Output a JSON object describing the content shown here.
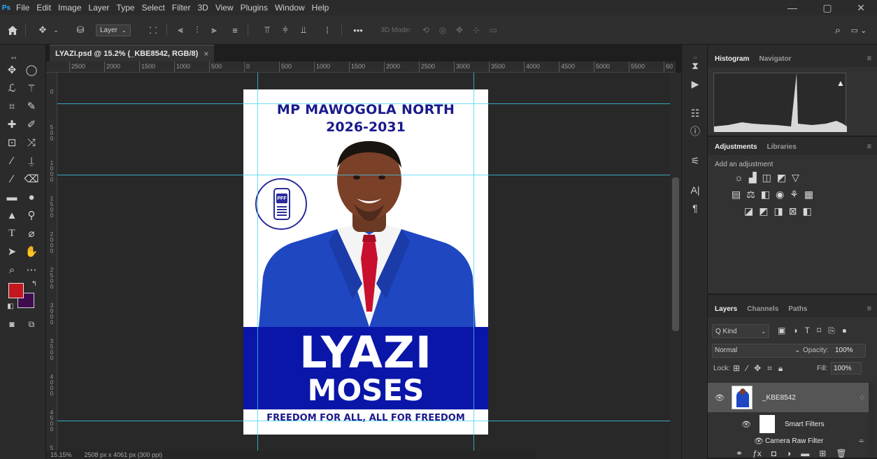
{
  "menubar": {
    "logo": "Ps",
    "items": [
      "File",
      "Edit",
      "Image",
      "Layer",
      "Type",
      "Select",
      "Filter",
      "3D",
      "View",
      "Plugins",
      "Window",
      "Help"
    ],
    "minimize": "—",
    "maximize": "▢",
    "close": "✕"
  },
  "options": {
    "home_icon": "home-icon",
    "layer_dropdown": "Layer",
    "more": "•••",
    "mode_3d": "3D Mode:"
  },
  "document": {
    "tab_title": "LYAZI.psd @ 15.2% (_KBE8542, RGB/8)",
    "tab_close": "×",
    "poster": {
      "heading": "MP MAWOGOLA NORTH",
      "years": "2026-2031",
      "logo_text": "PFF",
      "name_first": "LYAZI",
      "name_last": "MOSES",
      "slogan": "FREEDOM FOR ALL, ALL FOR FREEDOM",
      "banner_color": "#0a16a8",
      "heading_color": "#1a1a8c"
    }
  },
  "ruler_h_labels": [
    "2500",
    "2000",
    "1500",
    "1000",
    "500",
    "0",
    "500",
    "1000",
    "1500",
    "2000",
    "2500",
    "3000",
    "3500",
    "4000",
    "4500",
    "5000",
    "5500",
    "60"
  ],
  "ruler_v_labels": [
    "0",
    "500",
    "1000",
    "1500",
    "2000",
    "2500",
    "3000",
    "3500",
    "4000",
    "4500",
    "5"
  ],
  "status": {
    "zoom": "15.15%",
    "dimensions": "2508 px x 4061 px (300 ppi)"
  },
  "swatches": {
    "foreground": "#c4161c",
    "background": "#3f0d4e"
  },
  "histogram_panel": {
    "tabs": [
      "Histogram",
      "Navigator"
    ],
    "warning": "▲"
  },
  "adjustments_panel": {
    "tabs": [
      "Adjustments",
      "Libraries"
    ],
    "hint": "Add an adjustment"
  },
  "layers_panel": {
    "tabs": [
      "Layers",
      "Channels",
      "Paths"
    ],
    "filter_kind": "Q Kind",
    "blend_mode": "Normal",
    "opacity_label": "Opacity:",
    "opacity_value": "100%",
    "lock_label": "Lock:",
    "fill_label": "Fill:",
    "fill_value": "100%",
    "layers": [
      {
        "name": "_KBE8542"
      },
      {
        "name": "Smart Filters"
      },
      {
        "name": "Camera Raw Filter"
      }
    ]
  }
}
